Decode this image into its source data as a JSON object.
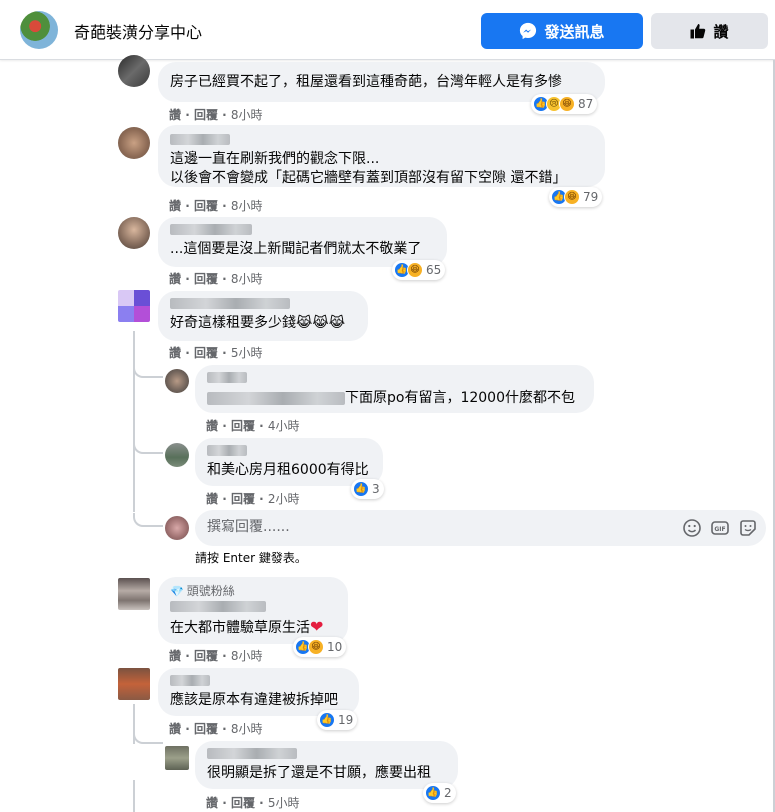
{
  "header": {
    "page_name": "奇葩裝潢分享中心",
    "message_button": "發送訊息",
    "like_button": "讚"
  },
  "labels": {
    "like": "讚",
    "reply": "回覆",
    "sep": "·"
  },
  "comments": [
    {
      "text": "房子已經買不起了，租屋還看到這種奇葩，台灣年輕人是有多慘",
      "time": "8小時",
      "reactions": [
        "like",
        "sad",
        "haha"
      ],
      "count": "87"
    },
    {
      "text": "這邊一直在刷新我們的觀念下限...",
      "text2": "以後會不會變成「起碼它牆壁有蓋到頂部沒有留下空隙 還不錯」",
      "time": "8小時",
      "reactions": [
        "like",
        "haha"
      ],
      "count": "79"
    },
    {
      "text": "...這個要是沒上新聞記者們就太不敬業了",
      "time": "8小時",
      "reactions": [
        "like",
        "haha"
      ],
      "count": "65"
    },
    {
      "text": "好奇這樣租要多少錢😹😹😹",
      "time": "5小時"
    },
    {
      "text": "下面原po有留言，12000什麼都不包",
      "time": "4小時"
    },
    {
      "text": "和美心房月租6000有得比",
      "time": "2小時",
      "reactions": [
        "like"
      ],
      "count": "3"
    },
    {
      "badge": "頭號粉絲",
      "text": "在大都市體驗草原生活",
      "time": "8小時",
      "reactions": [
        "like",
        "haha"
      ],
      "count": "10"
    },
    {
      "text": "應該是原本有違建被拆掉吧",
      "time": "8小時",
      "reactions": [
        "like"
      ],
      "count": "19"
    },
    {
      "text": "很明顯是拆了還是不甘願，應要出租",
      "time": "5小時",
      "reactions": [
        "like"
      ],
      "count": "2"
    }
  ],
  "composer": {
    "placeholder": "撰寫回覆......",
    "hint": "請按 Enter 鍵發表。"
  },
  "colors": {
    "accent": "#1877f2",
    "bubble": "#f0f2f5",
    "meta": "#65676b"
  }
}
